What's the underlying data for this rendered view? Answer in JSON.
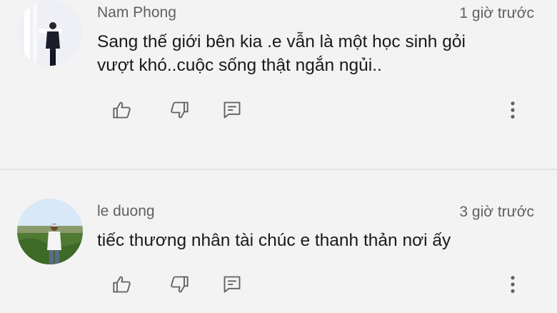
{
  "comments": [
    {
      "author": "Nam Phong",
      "time": "1 giờ trước",
      "text_line1": "Sang thế giới bên kia .e vẫn là một học sinh gỏi",
      "text_line2": "vượt khó..cuộc sống thật ngắn ngủi..",
      "avatar_icon": "person-photo-avatar"
    },
    {
      "author": "le duong",
      "time": "3 giờ trước",
      "text_line1": "tiếc thương nhân tài chúc e thanh thản nơi ấy",
      "avatar_icon": "person-landscape-avatar"
    }
  ],
  "actions": {
    "like_icon": "thumbs-up-icon",
    "dislike_icon": "thumbs-down-icon",
    "reply_icon": "reply-comment-icon",
    "more_icon": "more-vertical-icon"
  },
  "colors": {
    "background": "#f3f3f3",
    "author_text": "#606060",
    "body_text": "#1a1a1a",
    "icon": "#606060"
  }
}
